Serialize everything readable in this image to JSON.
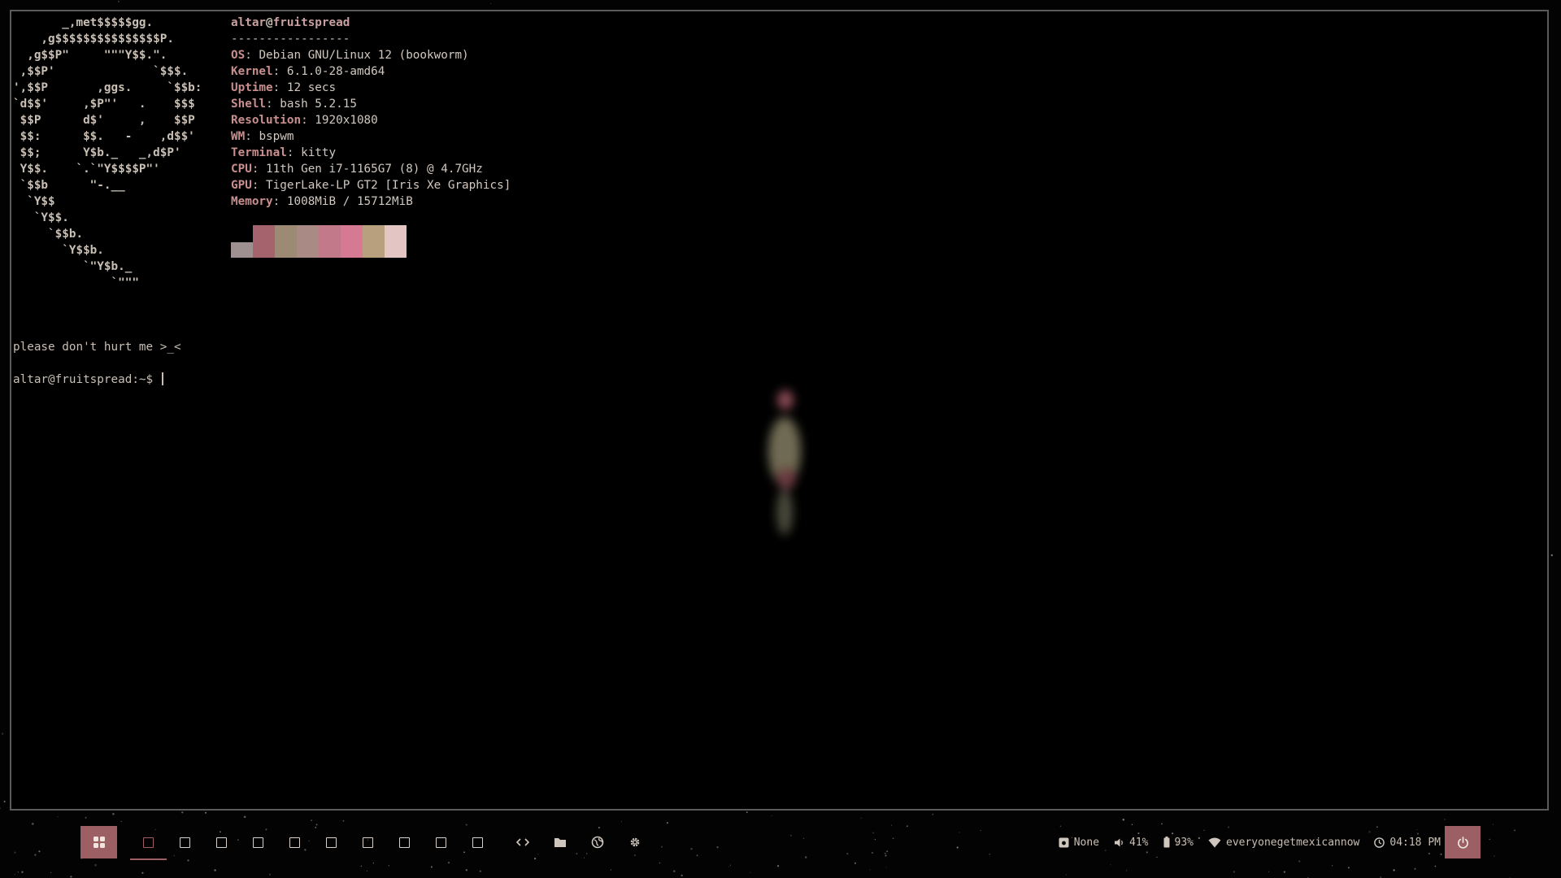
{
  "terminal": {
    "ascii_logo": [
      "       _,met$$$$$gg.",
      "    ,g$$$$$$$$$$$$$$$P.",
      "  ,g$$P\"     \"\"\"Y$$.\".",
      " ,$$P'              `$$$.",
      "',$$P       ,ggs.     `$$b:",
      "`d$$'     ,$P\"'   .    $$$",
      " $$P      d$'     ,    $$P",
      " $$:      $$.   -    ,d$$'",
      " $$;      Y$b._   _,d$P'",
      " Y$$.    `.`\"Y$$$$P\"'",
      " `$$b      \"-.__",
      "  `Y$$",
      "   `Y$$.",
      "     `$$b.",
      "       `Y$$b.",
      "          `\"Y$b._",
      "              `\"\"\""
    ],
    "user": "altar",
    "host": "fruitspread",
    "separator": "-----------------",
    "info": [
      {
        "key": "OS",
        "value": "Debian GNU/Linux 12 (bookworm)"
      },
      {
        "key": "Kernel",
        "value": "6.1.0-28-amd64"
      },
      {
        "key": "Uptime",
        "value": "12 secs"
      },
      {
        "key": "Shell",
        "value": "bash 5.2.15"
      },
      {
        "key": "Resolution",
        "value": "1920x1080"
      },
      {
        "key": "WM",
        "value": "bspwm"
      },
      {
        "key": "Terminal",
        "value": "kitty"
      },
      {
        "key": "CPU",
        "value": "11th Gen i7-1165G7 (8) @ 4.7GHz"
      },
      {
        "key": "GPU",
        "value": "TigerLake-LP GT2 [Iris Xe Graphics]"
      },
      {
        "key": "Memory",
        "value": "1008MiB / 15712MiB"
      }
    ],
    "palette": [
      "#9e9090",
      "#a4636d",
      "#9c8a74",
      "#a98a84",
      "#c27a8a",
      "#d57a92",
      "#b8a07e",
      "#e3c5c4"
    ],
    "message": "please don't hurt me >_<",
    "prompt": "altar@fruitspread:~$ "
  },
  "taskbar": {
    "launcher_icon": "grid-icon",
    "workspace_count": 10,
    "active_workspace": 1,
    "apps": [
      {
        "name": "code-editor",
        "icon": "code-icon"
      },
      {
        "name": "file-manager",
        "icon": "folder-icon"
      },
      {
        "name": "web-browser",
        "icon": "globe-icon"
      },
      {
        "name": "settings",
        "icon": "gear-icon"
      }
    ],
    "media_label": "None",
    "volume": "41%",
    "battery": "93%",
    "wifi_ssid": "everyonegetmexicannow",
    "clock": "04:18 PM",
    "power_icon": "power-icon"
  },
  "colors": {
    "accent": "#9c5f63",
    "text": "#c9bfb4",
    "key": "#c98e8e"
  }
}
